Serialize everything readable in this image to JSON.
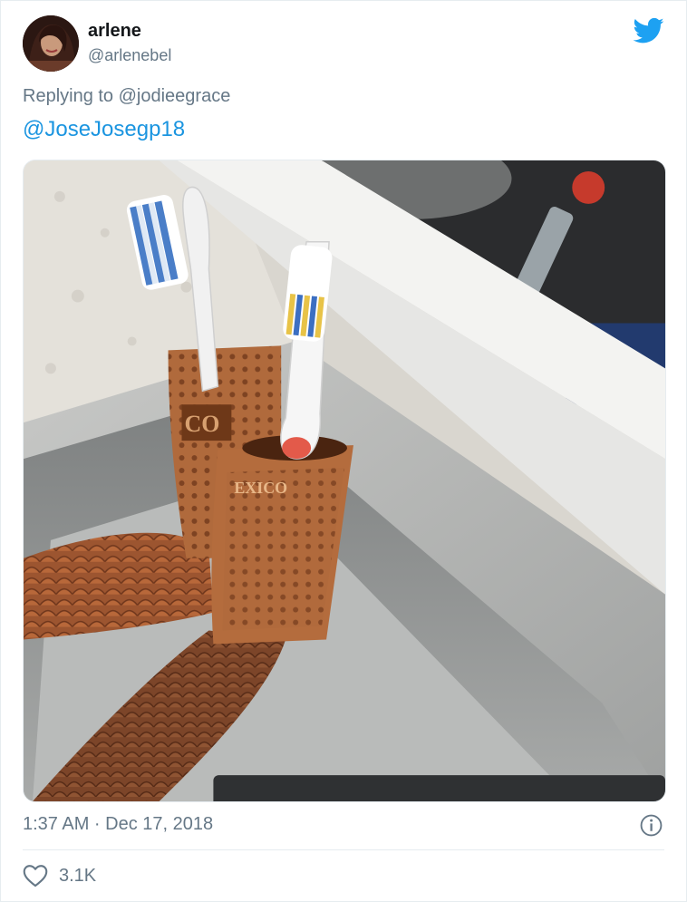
{
  "tweet": {
    "author_name": "arlene",
    "author_handle": "@arlenebel",
    "reply_prefix": "Replying to @jodieegrace",
    "body_mention": "@JoseJosegp18",
    "timestamp": "1:37 AM · Dec 17, 2018",
    "like_count": "3.1K"
  },
  "media": {
    "description_icon": "photo",
    "boot_stamp_text_1": "CO",
    "boot_stamp_text_2": "EXICO"
  },
  "icons": {
    "brand": "twitter-bird-icon",
    "info": "info-icon",
    "like": "heart-icon"
  },
  "colors": {
    "brand_blue": "#1da1f2",
    "link_blue": "#1b95e0",
    "secondary_text": "#657786"
  }
}
